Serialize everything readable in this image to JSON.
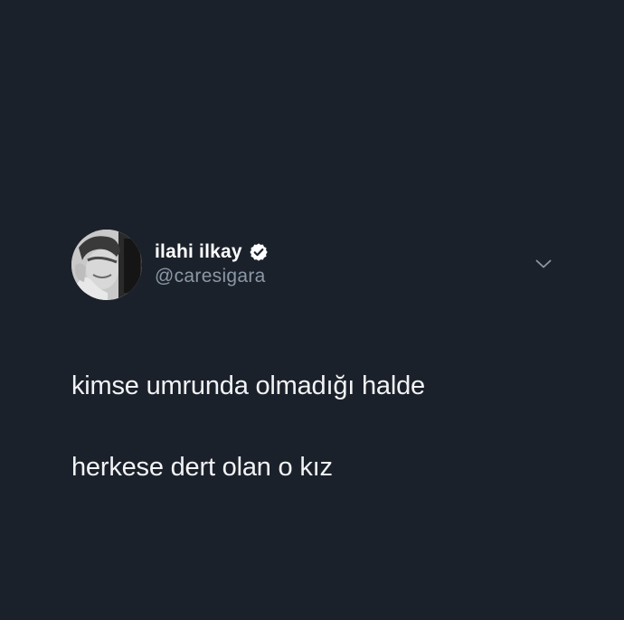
{
  "tweet": {
    "author": {
      "display_name": "ilahi ilkay",
      "handle": "@caresigara",
      "verified": true,
      "avatar_icon": "profile-photo"
    },
    "menu_icon": "chevron-down-icon",
    "text_lines": [
      "kimse umrunda olmadığı halde",
      "herkese dert olan o kız"
    ]
  },
  "colors": {
    "background": "#1b212b",
    "primary_text": "#ffffff",
    "secondary_text": "#8b98a5"
  }
}
